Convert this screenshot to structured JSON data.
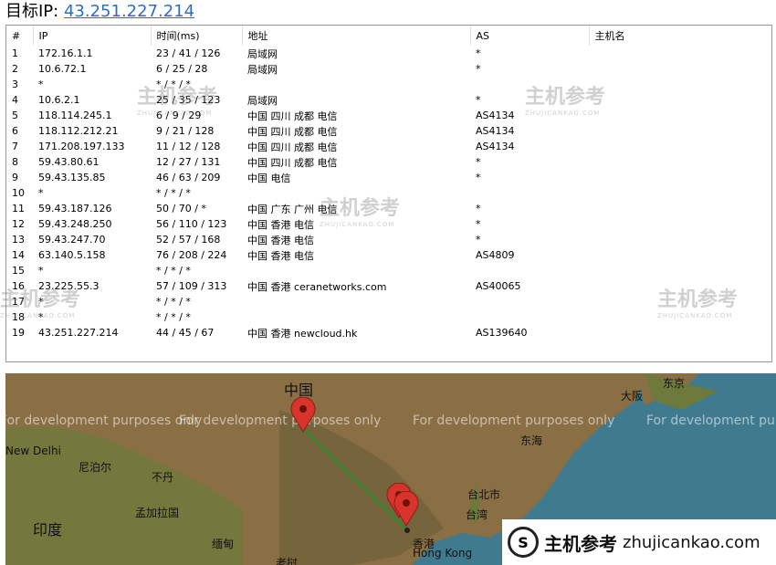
{
  "header": {
    "label": "目标IP:",
    "ip": "43.251.227.214"
  },
  "table": {
    "columns": [
      "#",
      "IP",
      "时间(ms)",
      "地址",
      "AS",
      "主机名"
    ],
    "rows": [
      [
        "1",
        "172.16.1.1",
        "23 / 41 / 126",
        "局域网",
        "*",
        ""
      ],
      [
        "2",
        "10.6.72.1",
        "6 / 25 / 28",
        "局域网",
        "*",
        ""
      ],
      [
        "3",
        "*",
        "* / * / *",
        "",
        "",
        ""
      ],
      [
        "4",
        "10.6.2.1",
        "25 / 35 / 123",
        "局域网",
        "*",
        ""
      ],
      [
        "5",
        "118.114.245.1",
        "6 / 9 / 29",
        "中国 四川 成都 电信",
        "AS4134",
        ""
      ],
      [
        "6",
        "118.112.212.21",
        "9 / 21 / 128",
        "中国 四川 成都 电信",
        "AS4134",
        ""
      ],
      [
        "7",
        "171.208.197.133",
        "11 / 12 / 128",
        "中国 四川 成都 电信",
        "AS4134",
        ""
      ],
      [
        "8",
        "59.43.80.61",
        "12 / 27 / 131",
        "中国 四川 成都 电信",
        "*",
        ""
      ],
      [
        "9",
        "59.43.135.85",
        "46 / 63 / 209",
        "中国 电信",
        "*",
        ""
      ],
      [
        "10",
        "*",
        "* / * / *",
        "",
        "",
        ""
      ],
      [
        "11",
        "59.43.187.126",
        "50 / 70 / *",
        "中国 广东 广州 电信",
        "*",
        ""
      ],
      [
        "12",
        "59.43.248.250",
        "56 / 110 / 123",
        "中国 香港 电信",
        "*",
        ""
      ],
      [
        "13",
        "59.43.247.70",
        "52 / 57 / 168",
        "中国 香港 电信",
        "*",
        ""
      ],
      [
        "14",
        "63.140.5.158",
        "76 / 208 / 224",
        "中国 香港 电信",
        "AS4809",
        ""
      ],
      [
        "15",
        "*",
        "* / * / *",
        "",
        "",
        ""
      ],
      [
        "16",
        "23.225.55.3",
        "57 / 109 / 313",
        "中国 香港 ceranetworks.com",
        "AS40065",
        ""
      ],
      [
        "17",
        "*",
        "* / * / *",
        "",
        "",
        ""
      ],
      [
        "18",
        "*",
        "* / * / *",
        "",
        "",
        ""
      ],
      [
        "19",
        "43.251.227.214",
        "44 / 45 / 67",
        "中国 香港 newcloud.hk",
        "AS139640",
        ""
      ]
    ]
  },
  "watermark": {
    "brand": "主机参考",
    "domain": "ZHUJICANKAO.COM"
  },
  "map": {
    "dev_notice": "For development purposes only",
    "labels": {
      "china": "中国",
      "new_delhi": "New Delhi",
      "nepal": "尼泊尔",
      "bhutan": "不丹",
      "bangladesh": "孟加拉国",
      "india": "印度",
      "myanmar": "缅甸",
      "laos": "老挝",
      "taipei": "台北市",
      "taiwan": "台湾",
      "hk_cn": "香港",
      "hk_en": "Hong Kong",
      "east_sea": "东海",
      "osaka": "大阪",
      "tokyo": "东京"
    },
    "colors": {
      "route": "#2e8b2e",
      "pin": "#d9342b",
      "land": "#9a7a4e",
      "sea": "#3f7a8f"
    }
  },
  "badge": {
    "logo": "S",
    "brand": "主机参考",
    "url": "zhujicankao.com"
  }
}
